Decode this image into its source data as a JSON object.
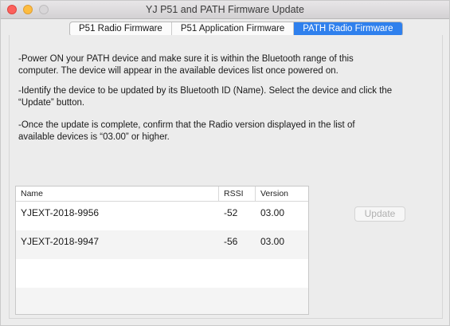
{
  "window": {
    "title": "YJ P51 and PATH Firmware Update"
  },
  "tabs": [
    {
      "label": "P51 Radio Firmware",
      "selected": false
    },
    {
      "label": "P51 Application Firmware",
      "selected": false
    },
    {
      "label": "PATH Radio Firmware",
      "selected": true
    }
  ],
  "instructions": [
    "-Power ON your PATH device and make sure it is within the Bluetooth range of this computer. The device will appear in the available devices list once powered on.",
    "-Identify the device to be updated by its Bluetooth ID (Name). Select the device and click the “Update” button.",
    "-Once the update is complete, confirm that the Radio version displayed in the list of available devices is “03.00” or higher."
  ],
  "devices": {
    "columns": [
      "Name",
      "RSSI",
      "Version"
    ],
    "rows": [
      {
        "name": "YJEXT-2018-9956",
        "rssi": "-52",
        "version": "03.00"
      },
      {
        "name": "YJEXT-2018-9947",
        "rssi": "-56",
        "version": "03.00"
      }
    ]
  },
  "update_button": {
    "label": "Update",
    "enabled": false
  },
  "colors": {
    "accent": "#2f80ed",
    "window_bg": "#ececec",
    "close": "#fc605c",
    "minimize": "#fdbc40"
  }
}
